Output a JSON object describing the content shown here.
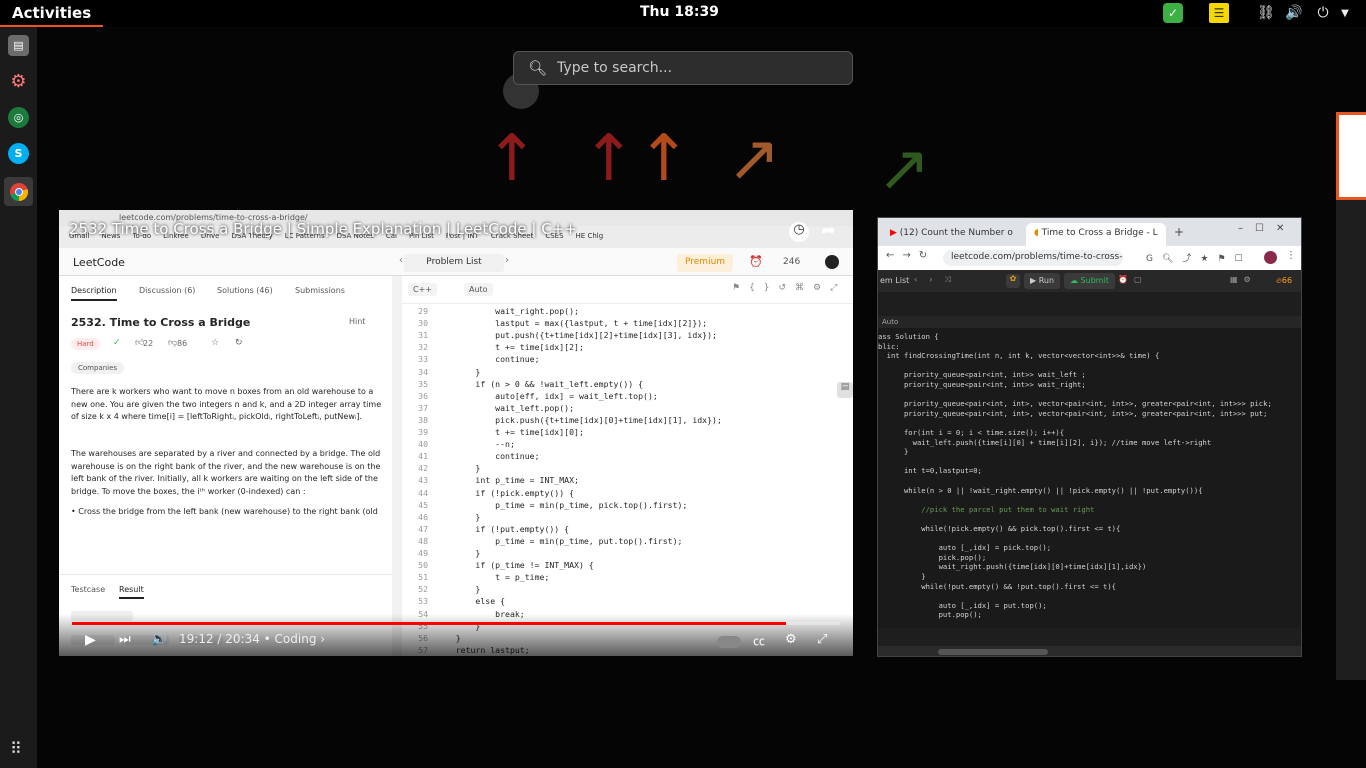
{
  "topbar": {
    "activities": "Activities",
    "clock": "Thu 18:39",
    "tray": {
      "update_icon": "check-shield-icon",
      "notes_icon": "notes-icon",
      "network_icon": "network-icon",
      "volume_icon": "volume-icon",
      "power_icon": "power-icon"
    }
  },
  "dock": {
    "items": [
      {
        "name": "files",
        "icon": "file-cabinet-icon"
      },
      {
        "name": "settings",
        "icon": "gear-icon"
      },
      {
        "name": "green-app",
        "icon": "globe-icon"
      },
      {
        "name": "skype",
        "icon": "skype-icon",
        "label": "S"
      },
      {
        "name": "chrome",
        "icon": "chrome-icon"
      }
    ],
    "apps_icon": "apps-grid-icon"
  },
  "search": {
    "placeholder": "Type to search..."
  },
  "video": {
    "title": "2532 Time to Cross a Bridge | Simple Explanation | LeetCode | C++",
    "time": "19:12 / 20:34 • Coding ›",
    "progress": 0.93,
    "browser_url": "leetcode.com/problems/time-to-cross-a-bridge/",
    "bookmarks": [
      "Gmail",
      "News",
      "To-do",
      "Linkree",
      "Drive",
      "DSA Theory",
      "LC Patterns",
      "DSA Notes",
      "Cal",
      "Pin List",
      "Post | INT",
      "Crack Sheet",
      "CSES",
      "HE Chlg"
    ],
    "leetcode": {
      "logo": "LeetCode",
      "problem_list": "Problem List",
      "premium": "Premium",
      "streak": "246",
      "tabs": [
        "Description",
        "Discussion (6)",
        "Solutions (46)",
        "Submissions"
      ],
      "title": "2532. Time to Cross a Bridge",
      "hint": "Hint",
      "difficulty": "Hard",
      "likes": "22",
      "dislikes": "86",
      "companies": "Companies",
      "para1": "There are k workers who want to move n boxes from an old warehouse to a new one. You are given the two integers n and k, and a 2D integer array time of size k x 4 where time[i] = [leftToRightᵢ, pickOldᵢ, rightToLeftᵢ, putNewᵢ].",
      "para2": "The warehouses are separated by a river and connected by a bridge. The old warehouse is on the right bank of the river, and the new warehouse is on the left bank of the river. Initially, all k workers are waiting on the left side of the bridge. To move the boxes, the iᵗʰ worker (0-indexed) can :",
      "para3": "• Cross the bridge from the left bank (new warehouse) to the right bank (old",
      "console_tabs": [
        "Testcase",
        "Result"
      ],
      "lang": "C++",
      "auto": "Auto",
      "code": [
        {
          "n": "29",
          "t": "            wait_right.pop();"
        },
        {
          "n": "30",
          "t": "            lastput = max({lastput, t + time[idx][2]});"
        },
        {
          "n": "31",
          "t": "            put.push({t+time[idx][2]+time[idx][3], idx});"
        },
        {
          "n": "32",
          "t": "            t += time[idx][2];"
        },
        {
          "n": "33",
          "t": "            continue;"
        },
        {
          "n": "34",
          "t": "        }"
        },
        {
          "n": "35",
          "t": "        if (n > 0 && !wait_left.empty()) {"
        },
        {
          "n": "36",
          "t": "            auto[eff, idx] = wait_left.top();"
        },
        {
          "n": "37",
          "t": "            wait_left.pop();"
        },
        {
          "n": "38",
          "t": "            pick.push({t+time[idx][0]+time[idx][1], idx});"
        },
        {
          "n": "39",
          "t": "            t += time[idx][0];"
        },
        {
          "n": "40",
          "t": "            --n;"
        },
        {
          "n": "41",
          "t": "            continue;"
        },
        {
          "n": "42",
          "t": "        }"
        },
        {
          "n": "43",
          "t": "        int p_time = INT_MAX;"
        },
        {
          "n": "44",
          "t": "        if (!pick.empty()) {"
        },
        {
          "n": "45",
          "t": "            p_time = min(p_time, pick.top().first);"
        },
        {
          "n": "46",
          "t": "        }"
        },
        {
          "n": "47",
          "t": "        if (!put.empty()) {"
        },
        {
          "n": "48",
          "t": "            p_time = min(p_time, put.top().first);"
        },
        {
          "n": "49",
          "t": "        }"
        },
        {
          "n": "50",
          "t": "        if (p_time != INT_MAX) {"
        },
        {
          "n": "51",
          "t": "            t = p_time;"
        },
        {
          "n": "52",
          "t": "        }"
        },
        {
          "n": "53",
          "t": "        else {"
        },
        {
          "n": "54",
          "t": "            break;"
        },
        {
          "n": "55",
          "t": "        }"
        },
        {
          "n": "56",
          "t": "    }"
        },
        {
          "n": "57",
          "t": "    return lastput;"
        }
      ]
    }
  },
  "right_window": {
    "tab1": "(12) Count the Number o",
    "tab2": "Time to Cross a Bridge - L",
    "url": "leetcode.com/problems/time-to-cross-a-...",
    "lc_list": "em List",
    "run": "Run",
    "submit": "Submit",
    "streak": "66",
    "auto": "Auto",
    "code": [
      "ass Solution {",
      "blic:",
      "  int findCrossingTime(int n, int k, vector<vector<int>>& time) {",
      "",
      "      priority_queue<pair<int, int>> wait_left ;",
      "      priority_queue<pair<int, int>> wait_right;",
      "",
      "      priority_queue<pair<int, int>, vector<pair<int, int>>, greater<pair<int, int>>> pick;",
      "      priority_queue<pair<int, int>, vector<pair<int, int>>, greater<pair<int, int>>> put;",
      "",
      "      for(int i = 0; i < time.size(); i++){",
      "        wait_left.push({time[i][0] + time[i][2], i}); //time move left->right",
      "      }",
      "",
      "      int t=0,lastput=0;",
      "",
      "      while(n > 0 || !wait_right.empty() || !pick.empty() || !put.empty()){",
      "",
      "          //pick the parcel put them to wait right",
      "",
      "          while(!pick.empty() && pick.top().first <= t){",
      "",
      "              auto [_,idx] = pick.top();",
      "              pick.pop();",
      "              wait_right.push({time[idx][0]+time[idx][1],idx})",
      "          }",
      "          while(!put.empty() && !put.top().first <= t){",
      "",
      "              auto [_,idx] = put.top();",
      "              put.pop();"
    ]
  }
}
